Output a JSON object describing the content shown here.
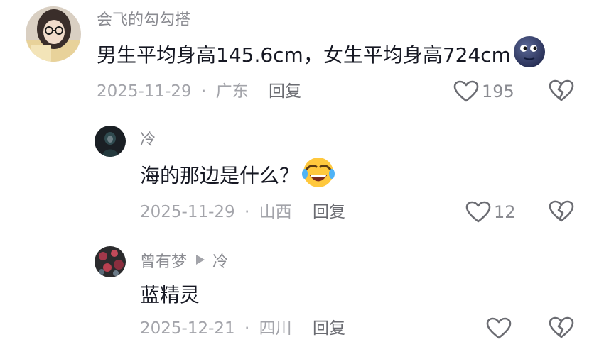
{
  "comments": [
    {
      "author": "会飞的勾勾搭",
      "text": "男生平均身高145.6cm，女生平均身高724cm",
      "emoji": "new-moon-face-emoji",
      "date": "2025-11-29",
      "location": "广东",
      "reply_label": "回复",
      "like_count": "195"
    },
    {
      "author": "冷",
      "text": "海的那边是什么？",
      "emoji": "rolling-on-floor-laughing-emoji",
      "date": "2025-11-29",
      "location": "山西",
      "reply_label": "回复",
      "like_count": "12"
    },
    {
      "author": "曾有梦",
      "reply_to": "冷",
      "text": "蓝精灵",
      "date": "2025-12-21",
      "location": "四川",
      "reply_label": "回复",
      "like_count": ""
    }
  ],
  "meta_separator": "·",
  "colors": {
    "primary_text": "#161823",
    "secondary_text": "#8a8b91",
    "meta_text": "#a3a4aa"
  },
  "icons": {
    "like": "heart-outline-icon",
    "dislike": "broken-heart-icon",
    "reply_arrow": "play-triangle-icon"
  }
}
